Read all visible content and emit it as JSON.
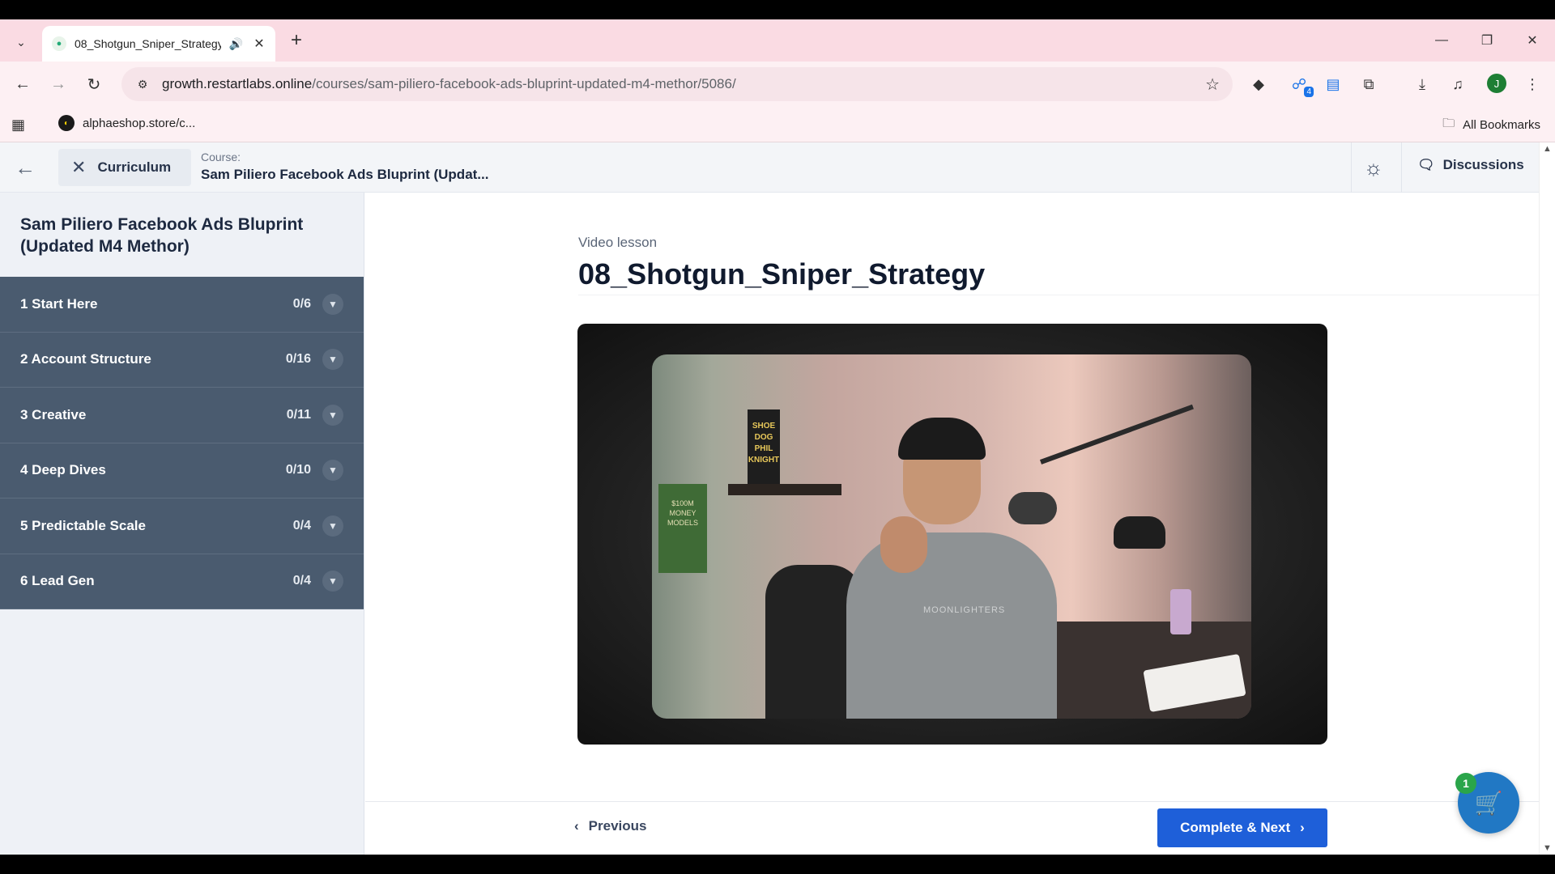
{
  "browser": {
    "tab_title": "08_Shotgun_Sniper_Strategy",
    "url_host": "growth.restartlabs.online",
    "url_path": "/courses/sam-piliero-facebook-ads-bluprint-updated-m4-methor/5086/",
    "ext_badge_count": "4",
    "profile_initial": "J",
    "bookmark_label": "alphaeshop.store/c...",
    "all_bookmarks_label": "All Bookmarks"
  },
  "topbar": {
    "curriculum_label": "Curriculum",
    "course_label": "Course:",
    "course_name": "Sam Piliero Facebook Ads Bluprint (Updat...",
    "discussions_label": "Discussions"
  },
  "sidebar": {
    "title": "Sam Piliero Facebook Ads Bluprint (Updated M4 Methor)",
    "topics": [
      {
        "label": "1 Start Here",
        "count": "0/6"
      },
      {
        "label": "2 Account Structure",
        "count": "0/16"
      },
      {
        "label": "3 Creative",
        "count": "0/11"
      },
      {
        "label": "4 Deep Dives",
        "count": "0/10"
      },
      {
        "label": "5 Predictable Scale",
        "count": "0/4"
      },
      {
        "label": "6 Lead Gen",
        "count": "0/4"
      }
    ]
  },
  "lesson": {
    "type_label": "Video lesson",
    "title": "08_Shotgun_Sniper_Strategy",
    "video_book1": "SHOE DOG PHIL KNIGHT",
    "video_book2": "$100M MONEY MODELS",
    "video_shirt_text": "MOONLIGHTERS"
  },
  "footer": {
    "previous_label": "Previous",
    "next_label": "Complete & Next"
  },
  "cart": {
    "badge_count": "1"
  },
  "colors": {
    "tabstrip": "#fadbe3",
    "sidebar_topic": "#4a5b6f",
    "primary_button": "#1e5fd9",
    "cart_fab": "#2178c4",
    "cart_badge": "#2aa54a"
  }
}
